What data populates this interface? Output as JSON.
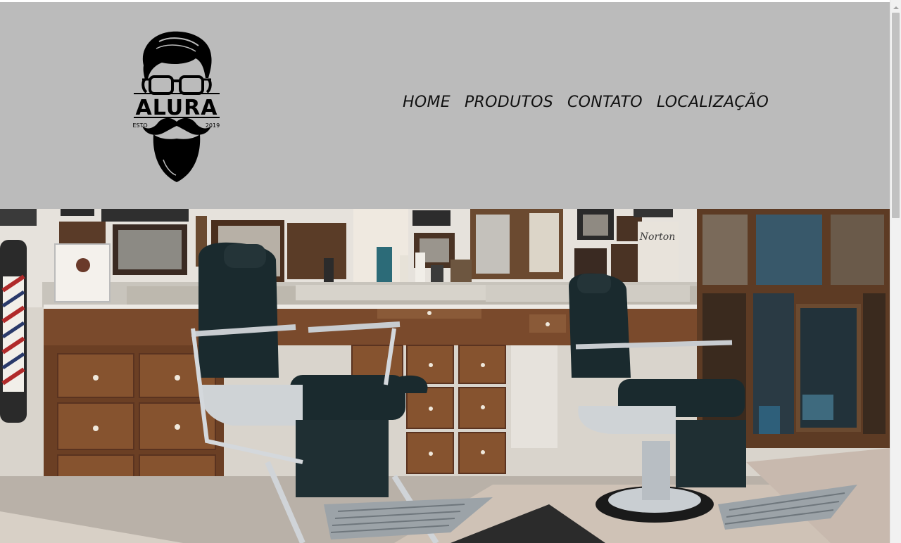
{
  "logo": {
    "brand": "ALURA",
    "left_text": "ESTO",
    "right_text": "2019",
    "icon": "bearded-man-icon"
  },
  "nav": [
    {
      "label": "HOME"
    },
    {
      "label": "PRODUTOS"
    },
    {
      "label": "CONTATO"
    },
    {
      "label": "LOCALIZAÇÃO"
    }
  ],
  "hero": {
    "photo": "barbershop-interior",
    "sign_text": "Norton"
  },
  "colors": {
    "header_bg": "#bbbbbb",
    "nav_text": "#111111",
    "wood": "#7a4a2c",
    "leather": "#1a2a2e"
  }
}
